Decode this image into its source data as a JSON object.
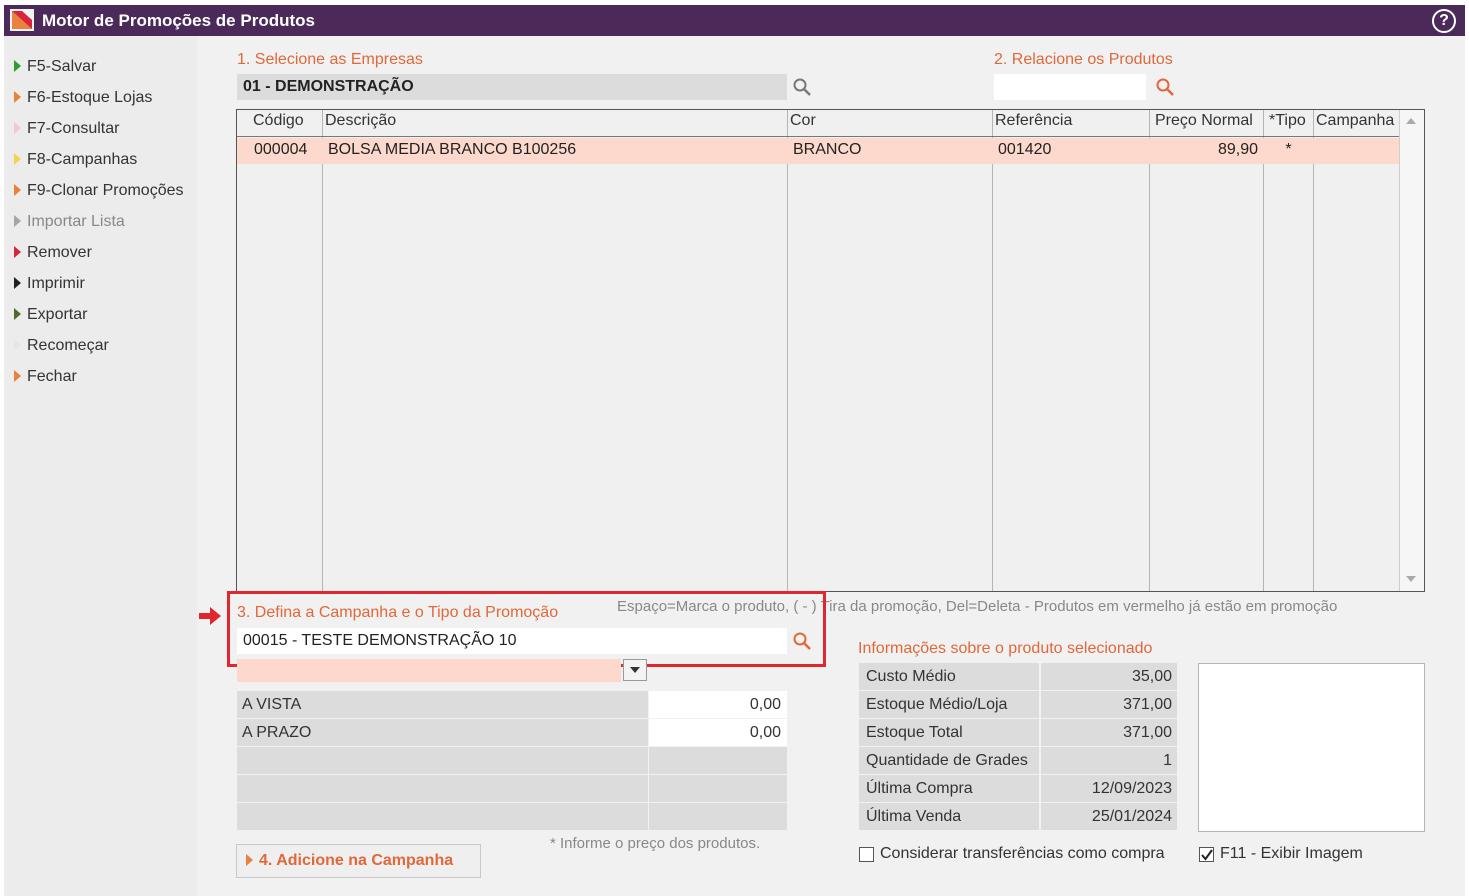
{
  "window": {
    "title": "Motor de Promoções de Produtos",
    "help_icon": "?"
  },
  "colors": {
    "titlebar": "#4b2a5a",
    "accent": "#e0683a",
    "highlight_row": "#fcd9cc",
    "annotation_red": "#e0262e"
  },
  "menu": [
    {
      "label": "F5-Salvar",
      "icon": "triangle-right-green",
      "color": "#2e9d2e"
    },
    {
      "label": "F6-Estoque Lojas",
      "icon": "triangle-right-orange",
      "color": "#e8823c"
    },
    {
      "label": "F7-Consultar",
      "icon": "triangle-right-pink",
      "color": "#f4c6d8"
    },
    {
      "label": "F8-Campanhas",
      "icon": "triangle-right-yellow",
      "color": "#f5d44a"
    },
    {
      "label": "F9-Clonar Promoções",
      "icon": "triangle-right-orange",
      "color": "#e8823c"
    },
    {
      "label": "Importar Lista",
      "icon": "triangle-right-gray",
      "color": "#a5a5a5"
    },
    {
      "label": "Remover",
      "icon": "triangle-right-red",
      "color": "#d8243c"
    },
    {
      "label": "Imprimir",
      "icon": "triangle-right-black",
      "color": "#222222"
    },
    {
      "label": "Exportar",
      "icon": "triangle-right-olive",
      "color": "#4d6b2a"
    },
    {
      "label": "Recomeçar",
      "icon": "triangle-right-white",
      "color": "#e6e6e6"
    },
    {
      "label": "Fechar",
      "icon": "triangle-right-orange",
      "color": "#e8823c"
    }
  ],
  "section1": {
    "label": "1. Selecione as Empresas",
    "value": "01 - DEMONSTRAÇÃO"
  },
  "section2": {
    "label": "2. Relacione os Produtos",
    "value": ""
  },
  "table": {
    "columns": [
      "Código",
      "Descrição",
      "Cor",
      "Referência",
      "Preço Normal",
      "*Tipo",
      "Campanha"
    ],
    "rows": [
      {
        "codigo": "000004",
        "descricao": "BOLSA MEDIA BRANCO B100256",
        "cor": "BRANCO",
        "referencia": "001420",
        "preco": "89,90",
        "tipo": "*",
        "campanha": ""
      }
    ]
  },
  "section3": {
    "label": "3. Defina a Campanha e o Tipo da Promoção",
    "hint": "Espaço=Marca o produto, ( - ) Tira da promoção, Del=Deleta - Produtos em vermelho já estão em promoção",
    "campaign_value": "00015 - TESTE DEMONSTRAÇÃO 10",
    "type_value": ""
  },
  "prices": [
    {
      "label": "A VISTA",
      "value": "0,00"
    },
    {
      "label": "A PRAZO",
      "value": "0,00"
    }
  ],
  "price_hint": "* Informe o preço dos produtos.",
  "add_button": {
    "label": "4. Adicione na Campanha"
  },
  "info": {
    "title": "Informações sobre o produto selecionado",
    "rows": [
      {
        "label": "Custo Médio",
        "value": "35,00"
      },
      {
        "label": "Estoque Médio/Loja",
        "value": "371,00"
      },
      {
        "label": "Estoque Total",
        "value": "371,00"
      },
      {
        "label": "Quantidade de Grades",
        "value": "1"
      },
      {
        "label": "Última Compra",
        "value": "12/09/2023"
      },
      {
        "label": "Última Venda",
        "value": "25/01/2024"
      }
    ],
    "consider_transfers": {
      "label": "Considerar transferências como compra",
      "checked": false
    },
    "show_image": {
      "label": "F11 - Exibir Imagem",
      "checked": true
    }
  }
}
